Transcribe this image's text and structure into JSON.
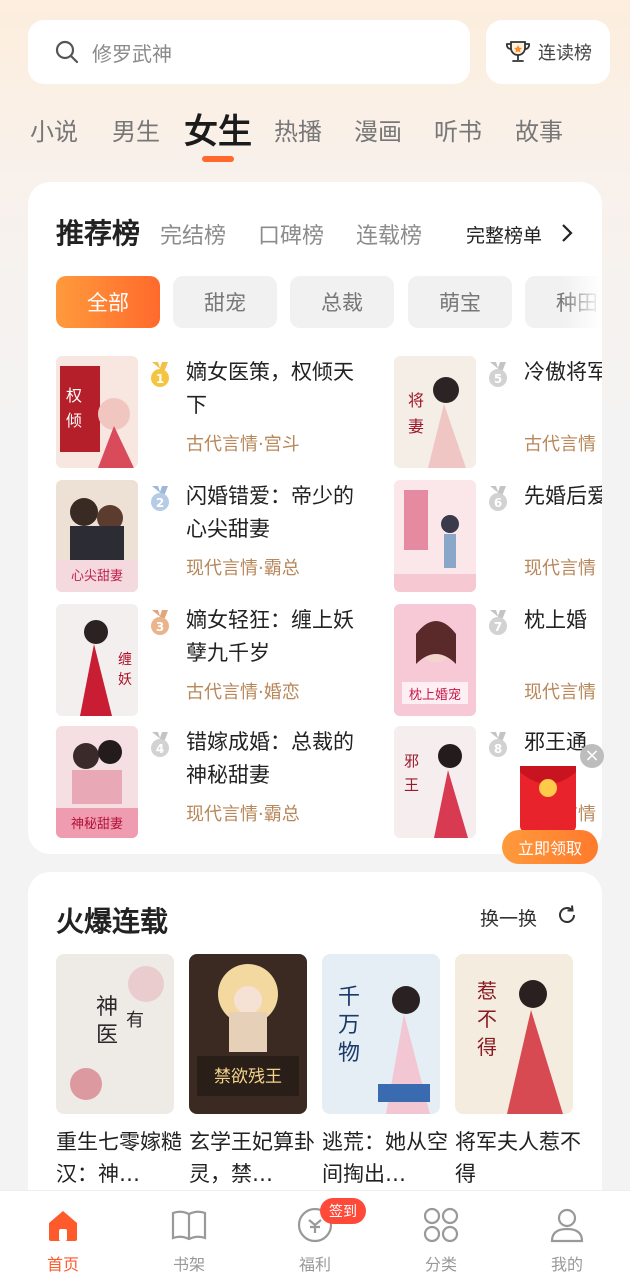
{
  "search": {
    "placeholder": "修罗武神",
    "icon": "search-icon"
  },
  "rank_button": {
    "label": "连读榜",
    "icon": "trophy-icon"
  },
  "tabs": [
    "小说",
    "男生",
    "女生",
    "热播",
    "漫画",
    "听书",
    "故事"
  ],
  "active_tab": "女生",
  "accent_color": "#ff6a2c",
  "ranking": {
    "title": "推荐榜",
    "sub_tabs": [
      "完结榜",
      "口碑榜",
      "连载榜"
    ],
    "full_list": "完整榜单",
    "chips": [
      "全部",
      "甜宠",
      "总裁",
      "萌宝",
      "种田"
    ],
    "active_chip": "全部",
    "books": [
      {
        "rank": "1",
        "title": "嫡女医策，权倾天下",
        "tag": "古代言情·宫斗"
      },
      {
        "rank": "2",
        "title": "闪婚错爱：帝少的心尖甜妻",
        "tag": "现代言情·霸总"
      },
      {
        "rank": "3",
        "title": "嫡女轻狂：缠上妖孽九千岁",
        "tag": "古代言情·婚恋"
      },
      {
        "rank": "4",
        "title": "错嫁成婚：总裁的神秘甜妻",
        "tag": "现代言情·霸总"
      },
      {
        "rank": "5",
        "title": "冷傲将军妻",
        "tag": "古代言情"
      },
      {
        "rank": "6",
        "title": "先婚后爱的隐婚",
        "tag": "现代言情"
      },
      {
        "rank": "7",
        "title": "枕上婚",
        "tag": "现代言情"
      },
      {
        "rank": "8",
        "title": "邪王通",
        "tag": "古代言情"
      }
    ]
  },
  "red_envelope": {
    "claim_label": "立即领取",
    "close": "×"
  },
  "hot_serial": {
    "title": "火爆连载",
    "swap_label": "换一换",
    "books": [
      {
        "title": "重生七零嫁糙汉：神…"
      },
      {
        "title": "玄学王妃算卦灵，禁…"
      },
      {
        "title": "逃荒：她从空间掏出…"
      },
      {
        "title": "将军夫人惹不得"
      }
    ]
  },
  "nav": {
    "items": [
      {
        "label": "首页",
        "icon": "home-icon"
      },
      {
        "label": "书架",
        "icon": "bookshelf-icon"
      },
      {
        "label": "福利",
        "icon": "welfare-icon"
      },
      {
        "label": "分类",
        "icon": "category-icon"
      },
      {
        "label": "我的",
        "icon": "profile-icon"
      }
    ],
    "active": "首页",
    "sign_badge": "签到"
  }
}
